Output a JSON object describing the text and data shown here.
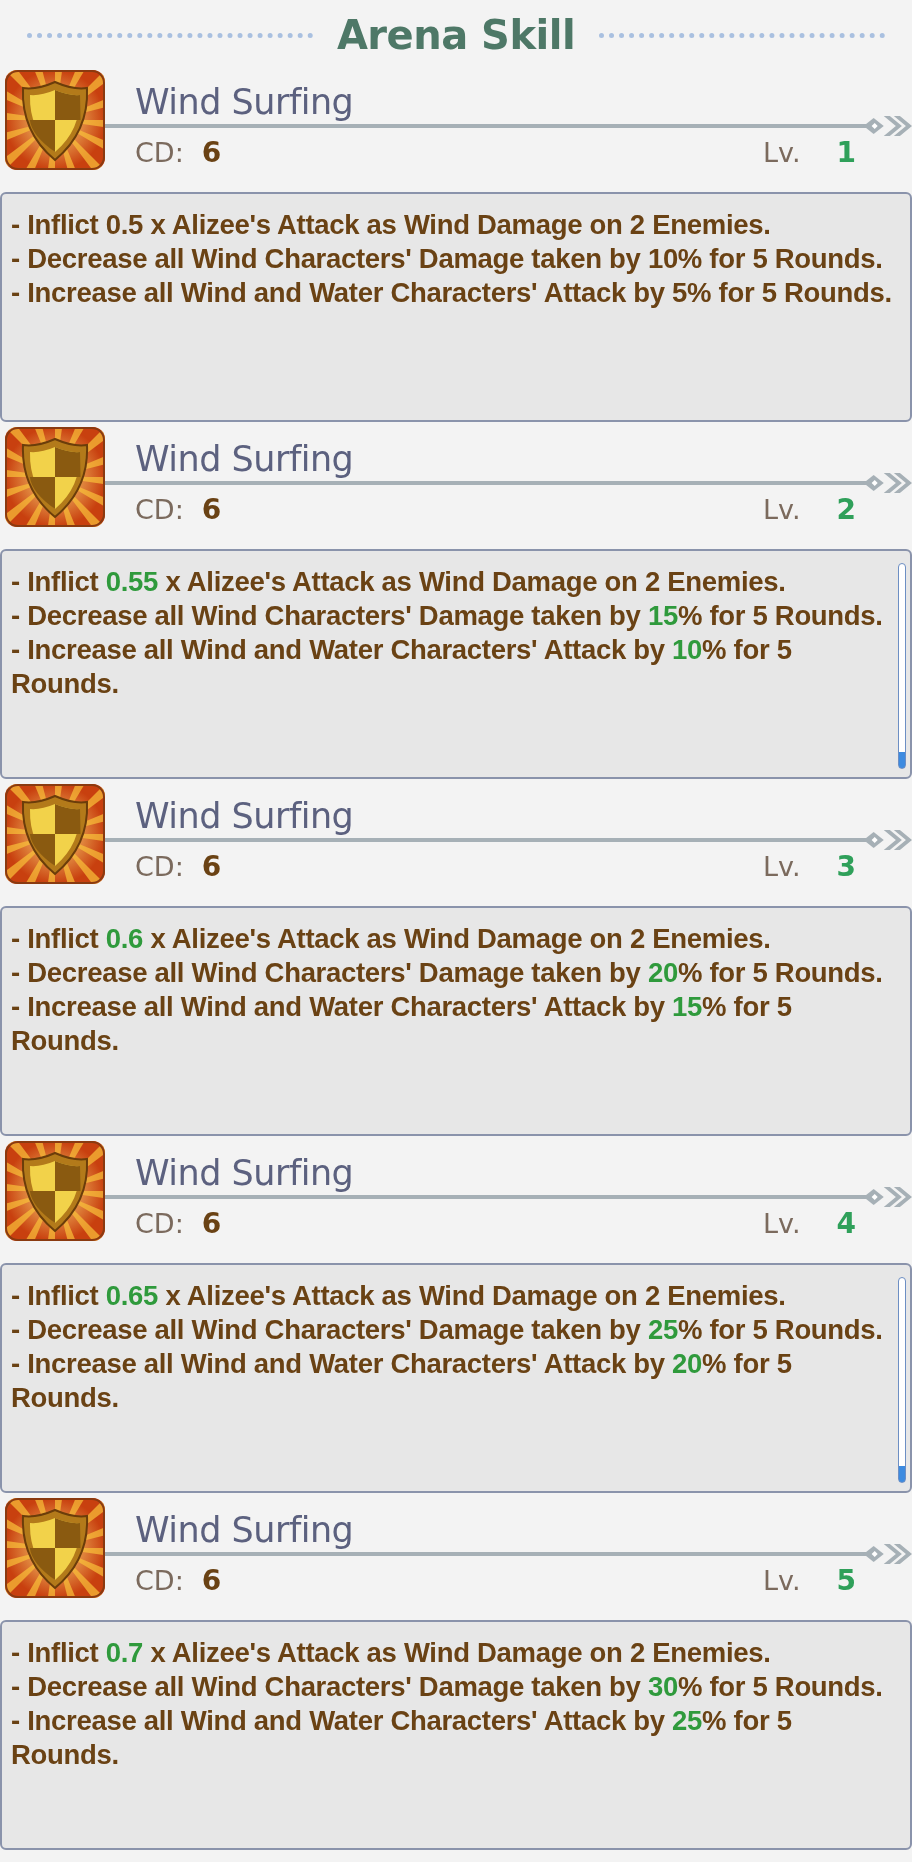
{
  "header": {
    "title": "Arena Skill"
  },
  "skills": [
    {
      "name": "Wind Surfing",
      "cd_label": "CD:",
      "cd_value": "6",
      "lv_label": "Lv.",
      "lv_value": "1",
      "scrollable": false,
      "effects": [
        [
          {
            "text": "- Inflict 0.5 x Alizee's Attack as Wind Damage on 2 Enemies.",
            "highlight": false
          }
        ],
        [
          {
            "text": "- Decrease all Wind Characters' Damage taken by 10% for 5 Rounds.",
            "highlight": false
          }
        ],
        [
          {
            "text": "- Increase all Wind and Water Characters' Attack by 5% for 5 Rounds.",
            "highlight": false
          }
        ]
      ]
    },
    {
      "name": "Wind Surfing",
      "cd_label": "CD:",
      "cd_value": "6",
      "lv_label": "Lv.",
      "lv_value": "2",
      "scrollable": true,
      "effects": [
        [
          {
            "text": "- Inflict ",
            "highlight": false
          },
          {
            "text": "0.55",
            "highlight": true
          },
          {
            "text": " x Alizee's Attack as Wind Damage on 2 Enemies.",
            "highlight": false
          }
        ],
        [
          {
            "text": "- Decrease all Wind Characters' Damage taken by ",
            "highlight": false
          },
          {
            "text": "15",
            "highlight": true
          },
          {
            "text": "% for 5 Rounds.",
            "highlight": false
          }
        ],
        [
          {
            "text": "- Increase all Wind and Water Characters' Attack by ",
            "highlight": false
          },
          {
            "text": "10",
            "highlight": true
          },
          {
            "text": "% for 5 Rounds.",
            "highlight": false
          }
        ]
      ]
    },
    {
      "name": "Wind Surfing",
      "cd_label": "CD:",
      "cd_value": "6",
      "lv_label": "Lv.",
      "lv_value": "3",
      "scrollable": false,
      "effects": [
        [
          {
            "text": "- Inflict ",
            "highlight": false
          },
          {
            "text": "0.6",
            "highlight": true
          },
          {
            "text": " x Alizee's Attack as Wind Damage on 2 Enemies.",
            "highlight": false
          }
        ],
        [
          {
            "text": "- Decrease all Wind Characters' Damage taken by ",
            "highlight": false
          },
          {
            "text": "20",
            "highlight": true
          },
          {
            "text": "% for 5 Rounds.",
            "highlight": false
          }
        ],
        [
          {
            "text": "- Increase all Wind and Water Characters' Attack by ",
            "highlight": false
          },
          {
            "text": "15",
            "highlight": true
          },
          {
            "text": "% for 5 Rounds.",
            "highlight": false
          }
        ]
      ]
    },
    {
      "name": "Wind Surfing",
      "cd_label": "CD:",
      "cd_value": "6",
      "lv_label": "Lv.",
      "lv_value": "4",
      "scrollable": true,
      "effects": [
        [
          {
            "text": "- Inflict ",
            "highlight": false
          },
          {
            "text": "0.65",
            "highlight": true
          },
          {
            "text": " x Alizee's Attack as Wind Damage on 2 Enemies.",
            "highlight": false
          }
        ],
        [
          {
            "text": "- Decrease all Wind Characters' Damage taken by ",
            "highlight": false
          },
          {
            "text": "25",
            "highlight": true
          },
          {
            "text": "% for 5 Rounds.",
            "highlight": false
          }
        ],
        [
          {
            "text": "- Increase all Wind and Water Characters' Attack by ",
            "highlight": false
          },
          {
            "text": "20",
            "highlight": true
          },
          {
            "text": "% for 5 Rounds.",
            "highlight": false
          }
        ]
      ]
    },
    {
      "name": "Wind Surfing",
      "cd_label": "CD:",
      "cd_value": "6",
      "lv_label": "Lv.",
      "lv_value": "5",
      "scrollable": false,
      "effects": [
        [
          {
            "text": "- Inflict ",
            "highlight": false
          },
          {
            "text": "0.7",
            "highlight": true
          },
          {
            "text": " x Alizee's Attack as Wind Damage on 2 Enemies.",
            "highlight": false
          }
        ],
        [
          {
            "text": "- Decrease all Wind Characters' Damage taken by ",
            "highlight": false
          },
          {
            "text": "30",
            "highlight": true
          },
          {
            "text": "% for 5 Rounds.",
            "highlight": false
          }
        ],
        [
          {
            "text": "- Increase all Wind and Water Characters' Attack by ",
            "highlight": false
          },
          {
            "text": "25",
            "highlight": true
          },
          {
            "text": "% for 5 Rounds.",
            "highlight": false
          }
        ]
      ]
    }
  ]
}
